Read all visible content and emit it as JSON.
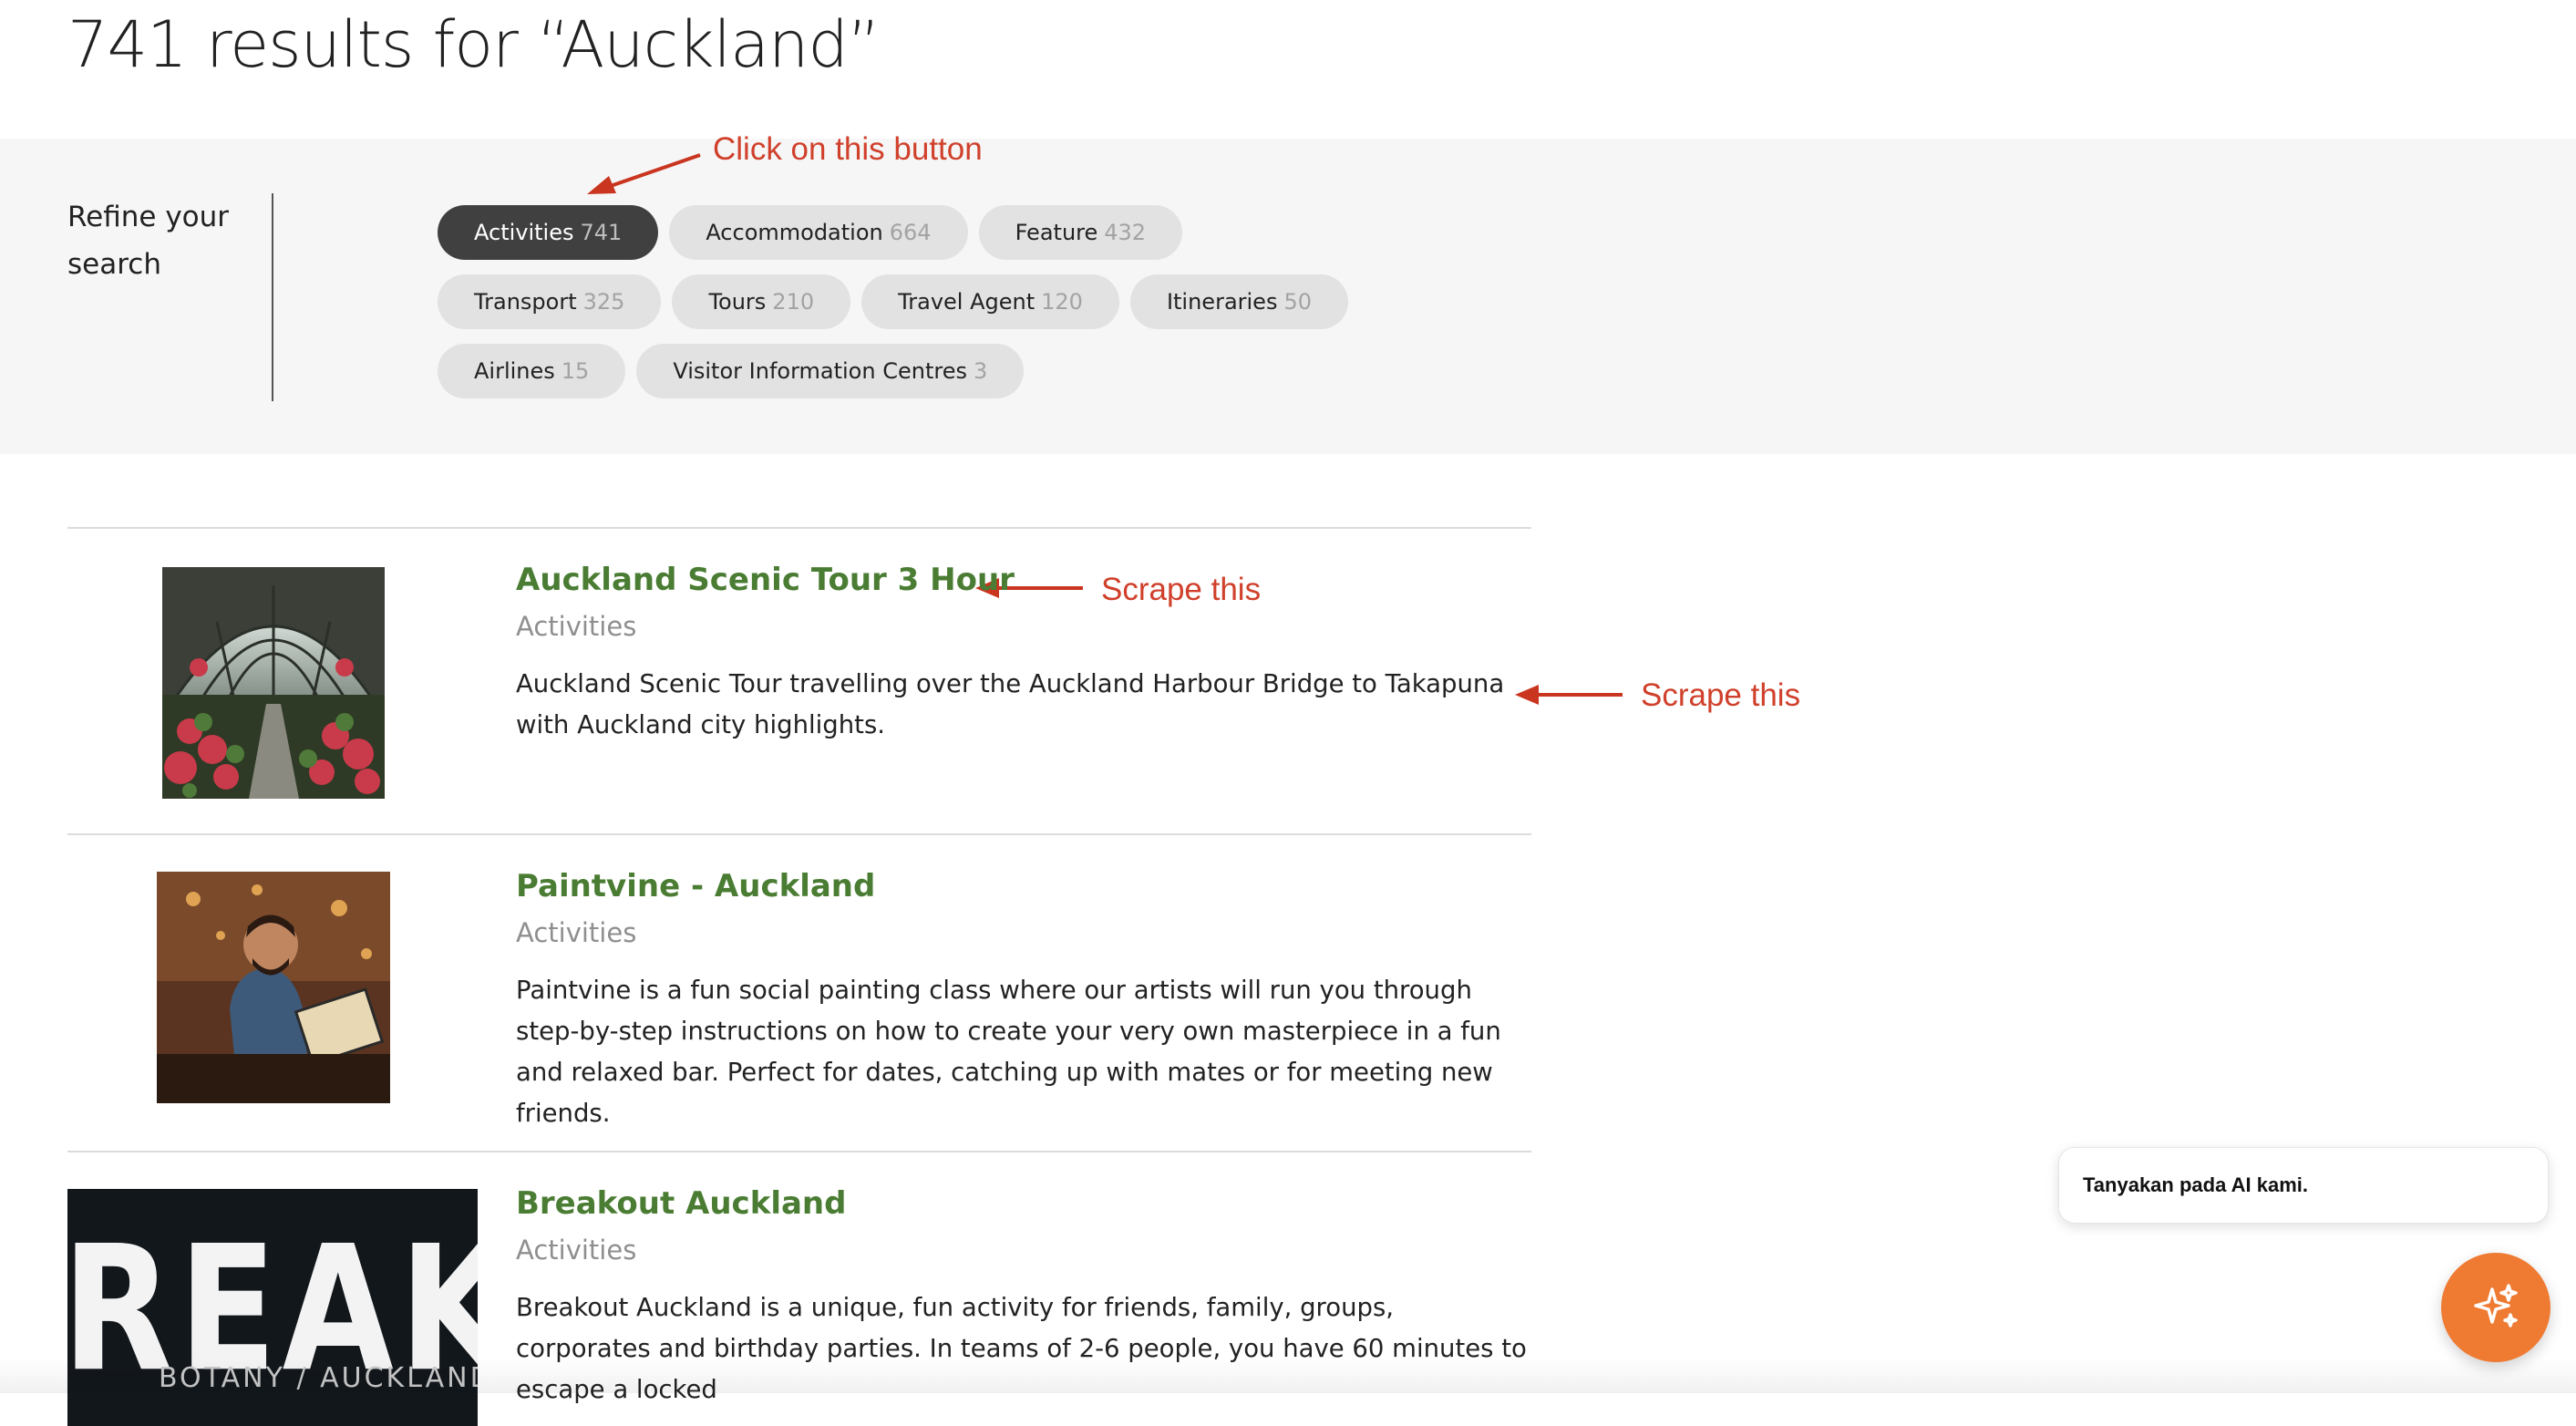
{
  "header": {
    "title": "741 results for “Auckland”"
  },
  "refine": {
    "label": "Refine your search",
    "chips": [
      {
        "label": "Activities",
        "count": "741",
        "active": true
      },
      {
        "label": "Accommodation",
        "count": "664",
        "active": false
      },
      {
        "label": "Feature",
        "count": "432",
        "active": false
      },
      {
        "label": "Transport",
        "count": "325",
        "active": false
      },
      {
        "label": "Tours",
        "count": "210",
        "active": false
      },
      {
        "label": "Travel Agent",
        "count": "120",
        "active": false
      },
      {
        "label": "Itineraries",
        "count": "50",
        "active": false
      },
      {
        "label": "Airlines",
        "count": "15",
        "active": false
      },
      {
        "label": "Visitor Information Centres",
        "count": "3",
        "active": false
      }
    ]
  },
  "annotations": {
    "click_button": "Click on this button",
    "scrape_title": "Scrape this",
    "scrape_desc": "Scrape this",
    "color": "#d0402b"
  },
  "results": [
    {
      "title": "Auckland Scenic Tour 3 Hour",
      "category": "Activities",
      "description": "Auckland Scenic Tour travelling over the Auckland Harbour Bridge to Takapuna with Auckland city highlights."
    },
    {
      "title": "Paintvine - Auckland",
      "category": "Activities",
      "description": "Paintvine is a fun social painting class where our artists will run you through step-by-step instructions on how to create your very own masterpiece in a fun and relaxed bar. Perfect for dates, catching up with mates or for meeting new friends."
    },
    {
      "title": "Breakout Auckland",
      "category": "Activities",
      "description": "Breakout Auckland is a unique, fun activity for friends, family, groups, corporates and birthday parties. In teams of 2-6 people, you have 60 minutes to escape a locked",
      "image_text": "REAKOU",
      "image_subtext": "BOTANY / AUCKLAND / ESCAPE"
    }
  ],
  "chat": {
    "prompt": "Tanyakan pada AI kami.",
    "button_icon": "sparkle-icon"
  },
  "colors": {
    "title_green": "#4a7d33",
    "active_chip": "#404040",
    "chip": "#e2e2e2",
    "fab_orange": "#ef7b33"
  }
}
